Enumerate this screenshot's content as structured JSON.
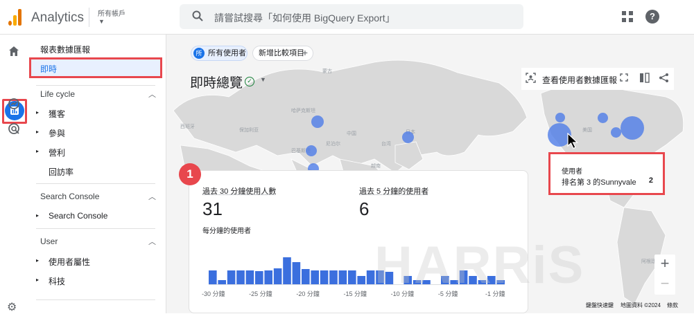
{
  "app": {
    "name": "Analytics",
    "account_label": "所有帳戶"
  },
  "search": {
    "placeholder": "請嘗試搜尋「如何使用 BigQuery Export」"
  },
  "nav": {
    "reports_snapshot": "報表數據匯報",
    "realtime": "即時",
    "sections": [
      {
        "title": "Life cycle",
        "items": [
          "獲客",
          "參與",
          "營利"
        ],
        "extra": "回訪率"
      },
      {
        "title": "Search Console",
        "items": [
          "Search Console"
        ]
      },
      {
        "title": "User",
        "items": [
          "使用者屬性",
          "科技"
        ]
      }
    ]
  },
  "filters": {
    "all_users": "所有使用者",
    "all_users_badge": "所",
    "add_comparison": "新增比較項目"
  },
  "page": {
    "title": "即時總覽",
    "view_snapshot": "查看使用者數據匯報"
  },
  "card": {
    "metric1_label": "過去 30 分鐘使用人數",
    "metric1_value": "31",
    "metric2_label": "過去 5 分鐘的使用者",
    "metric2_value": "6",
    "per_minute_label": "每分鐘的使用者",
    "badge": "1"
  },
  "tooltip": {
    "header": "使用者",
    "row_label": "排名第 3 的Sunnyvale",
    "row_value": "2"
  },
  "map_footer": {
    "shortcuts": "鍵盤快速鍵",
    "map_data": "地圖資料 ©2024",
    "terms": "條款"
  },
  "watermark": "HARRiS",
  "colors": {
    "accent": "#1a73e8",
    "bar": "#3b6fde",
    "highlight": "#e8474d"
  },
  "chart_data": {
    "type": "bar",
    "y_tick_label": "5",
    "x_tick_labels": [
      "-30 分鐘",
      "-25 分鐘",
      "-20 分鐘",
      "-15 分鐘",
      "-10 分鐘",
      "-5 分鐘",
      "-1 分鐘"
    ],
    "values": [
      2.0,
      0.6,
      2.0,
      2.0,
      2.0,
      1.9,
      2.0,
      2.3,
      3.9,
      3.2,
      2.2,
      2.0,
      2.0,
      2.0,
      2.0,
      2.0,
      1.2,
      2.0,
      2.0,
      1.8,
      0.0,
      1.2,
      0.6,
      0.6,
      0.0,
      1.2,
      0.6,
      2.0,
      1.2,
      0.6,
      1.2,
      0.6
    ],
    "ylim": [
      0,
      5
    ]
  }
}
